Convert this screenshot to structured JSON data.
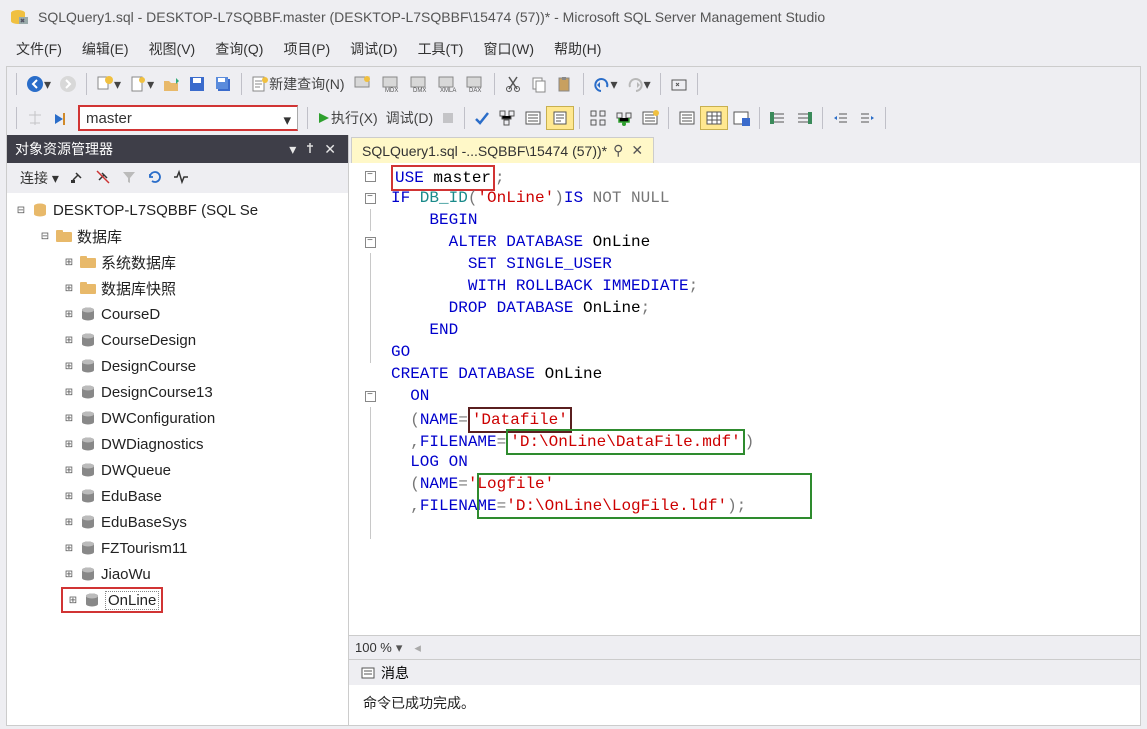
{
  "title": "SQLQuery1.sql - DESKTOP-L7SQBBF.master (DESKTOP-L7SQBBF\\15474 (57))* - Microsoft SQL Server Management Studio",
  "menu": {
    "file": "文件(F)",
    "edit": "编辑(E)",
    "view": "视图(V)",
    "query": "查询(Q)",
    "project": "项目(P)",
    "debug": "调试(D)",
    "tools": "工具(T)",
    "window": "窗口(W)",
    "help": "帮助(H)"
  },
  "toolbar": {
    "new_query": "新建查询(N)",
    "database_selected": "master",
    "execute": "执行(X)",
    "debug": "调试(D)"
  },
  "explorer": {
    "title": "对象资源管理器",
    "connect_label": "连接 ▾",
    "server": "DESKTOP-L7SQBBF (SQL Se",
    "databases_folder": "数据库",
    "system_db": "系统数据库",
    "snapshot": "数据库快照",
    "dbs": [
      "CourseD",
      "CourseDesign",
      "DesignCourse",
      "DesignCourse13",
      "DWConfiguration",
      "DWDiagnostics",
      "DWQueue",
      "EduBase",
      "EduBaseSys",
      "FZTourism11",
      "JiaoWu",
      "OnLine"
    ]
  },
  "tab": {
    "name": "SQLQuery1.sql -...SQBBF\\15474 (57))*"
  },
  "code": {
    "l1a": "USE",
    "l1b": " master",
    "l1c": ";",
    "l2a": "IF",
    "l2b": " DB_ID",
    "l2c": "(",
    "l2d": "'OnLine'",
    "l2e": ")",
    "l2f": "IS",
    "l2g": " NOT",
    "l2h": " NULL",
    "l3a": "    BEGIN",
    "l4a": "      ALTER",
    "l4b": " DATABASE",
    "l4c": " OnLine",
    "l5a": "        SET",
    "l5b": " SINGLE_USER",
    "l6a": "        WITH",
    "l6b": " ROLLBACK",
    "l6c": " IMMEDIATE",
    "l6d": ";",
    "l7a": "      DROP",
    "l7b": " DATABASE",
    "l7c": " OnLine",
    "l7d": ";",
    "l8a": "    END",
    "l9a": "GO",
    "l10a": "CREATE",
    "l10b": " DATABASE",
    "l10c": " OnLine",
    "l11a": "  ON",
    "l12a": "  (",
    "l12b": "NAME",
    "l12c": "=",
    "l12d": "'Datafile'",
    "l13a": "  ,",
    "l13b": "FILENAME",
    "l13c": "=",
    "l13d": "'D:\\OnLine\\DataFile.mdf'",
    "l13e": ")",
    "l14a": "  LOG",
    "l14b": " ON",
    "l15a": "  (",
    "l15b": "NAME",
    "l15c": "=",
    "l15d": "'Logfile'",
    "l16a": "  ,",
    "l16b": "FILENAME",
    "l16c": "=",
    "l16d": "'D:\\OnLine\\LogFile.ldf'",
    "l16e": ");"
  },
  "zoom": "100 %",
  "messages": {
    "tab": "消息",
    "body": "命令已成功完成。"
  }
}
